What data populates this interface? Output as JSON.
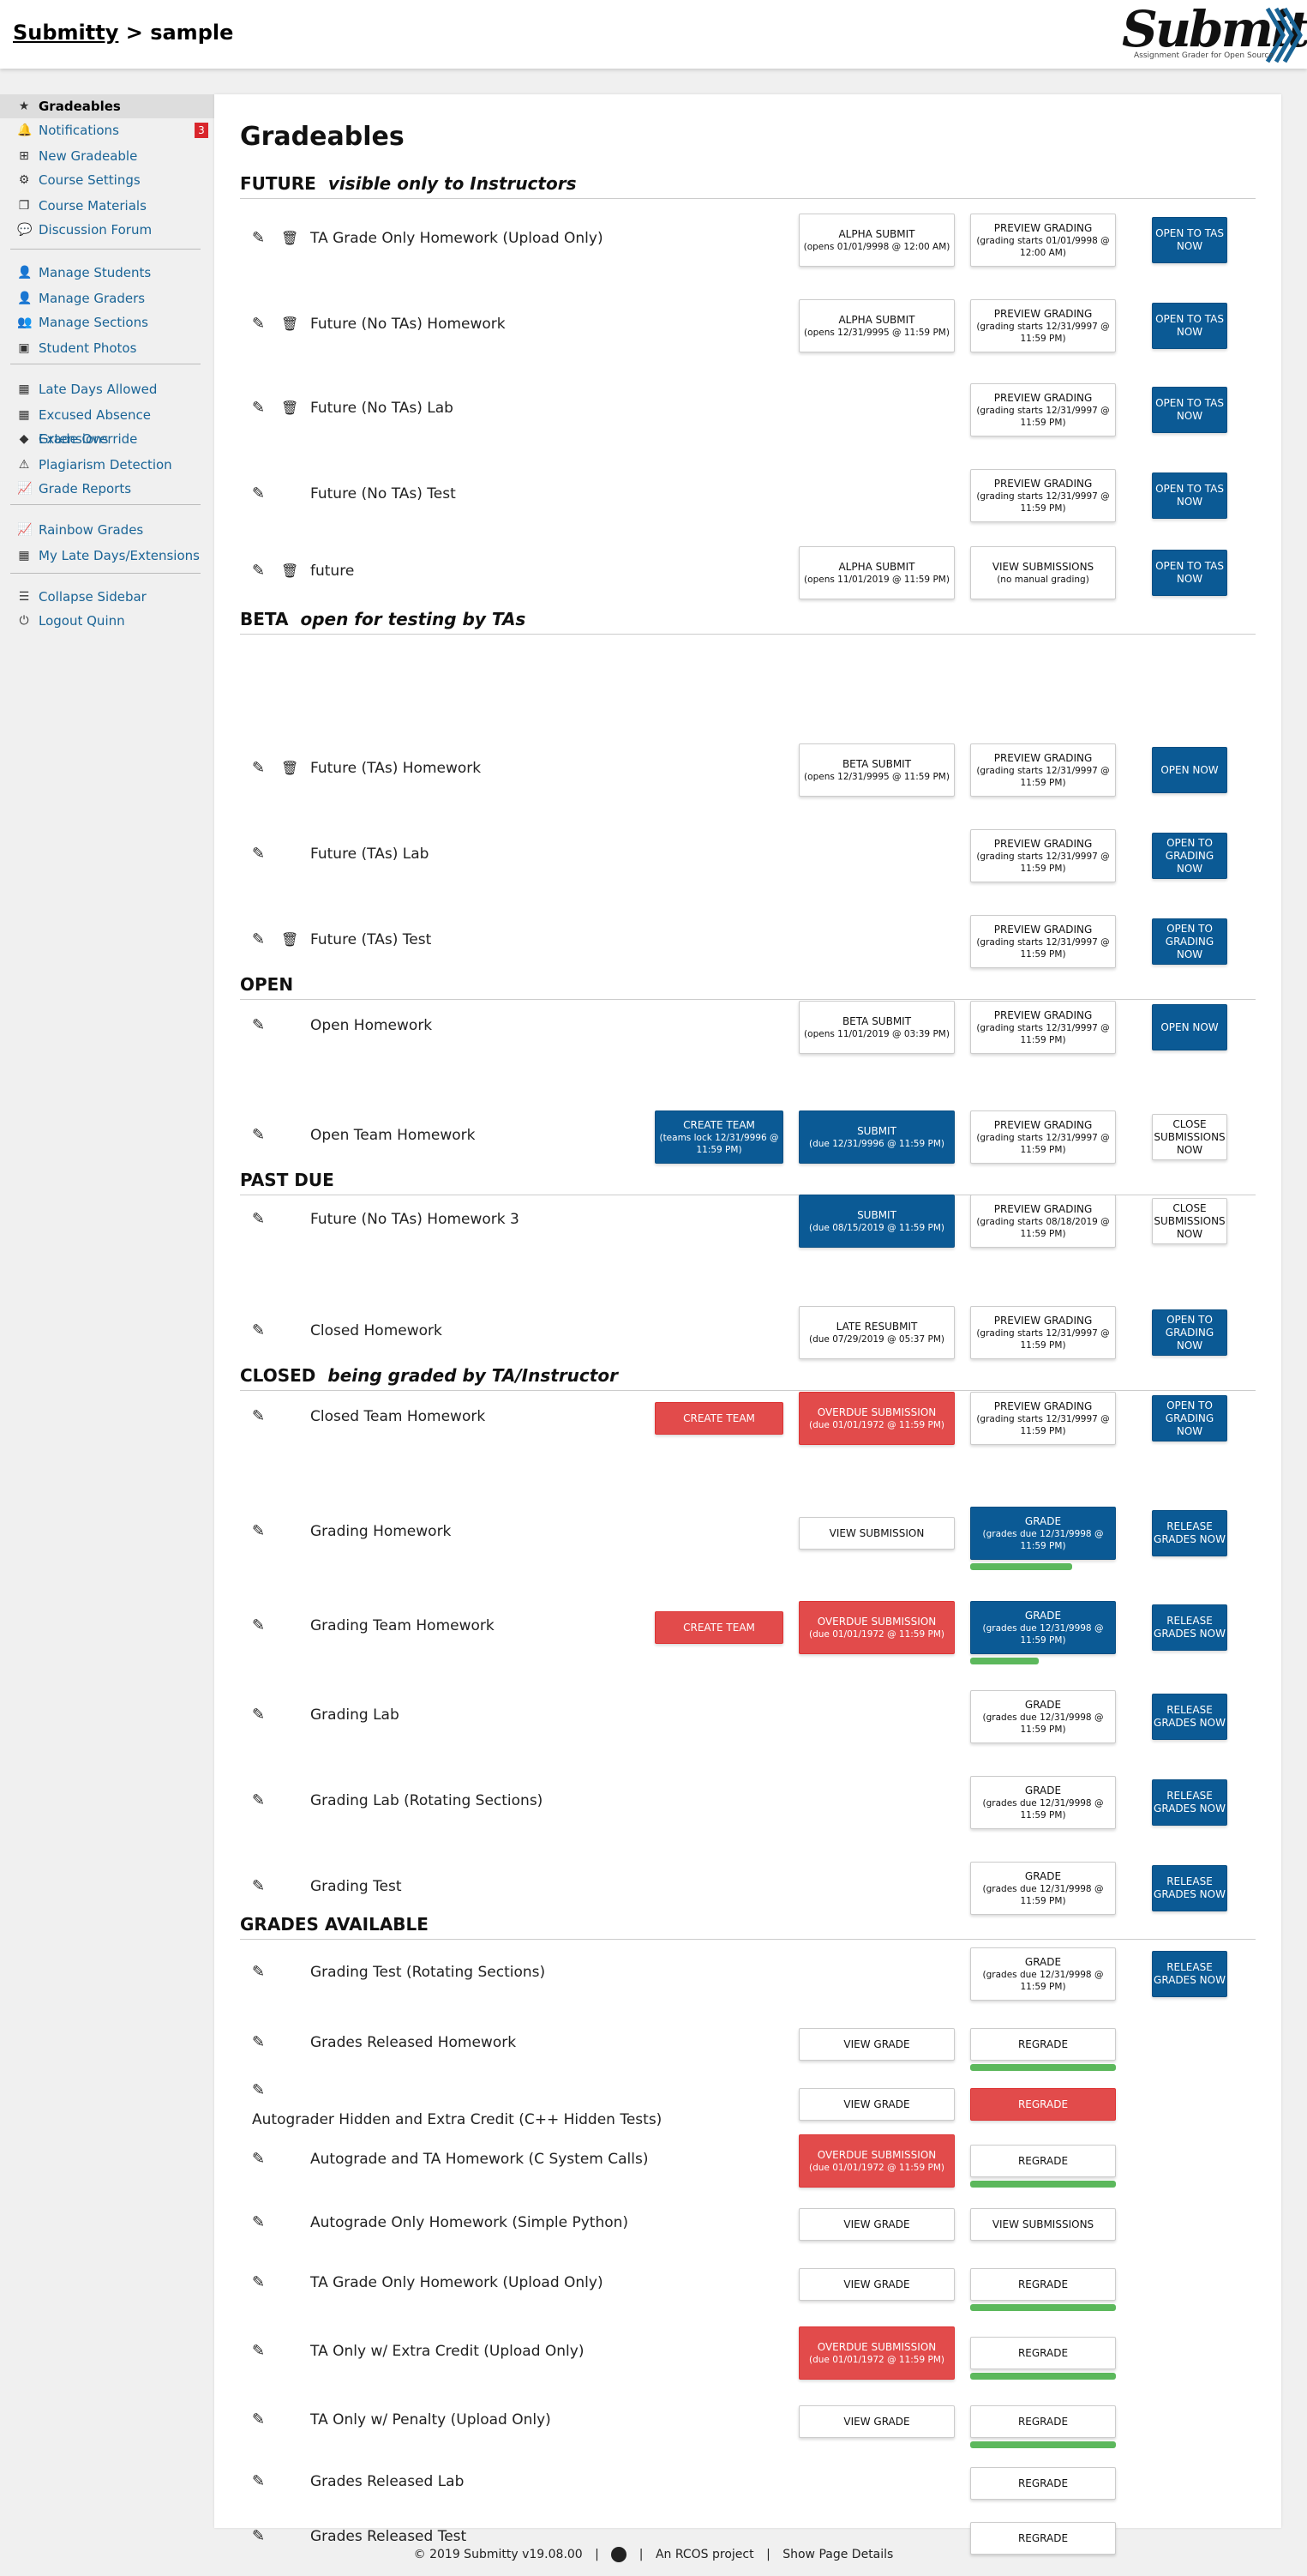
{
  "header": {
    "course_link": "Submitty",
    "separator": ">",
    "course": "sample"
  },
  "logo": {
    "word": "Submitty",
    "tagline": "Assignment Grader for Open Source"
  },
  "sidebar": {
    "items": [
      {
        "label": "Gradeables",
        "icon": "star-icon",
        "glyph": "★"
      },
      {
        "label": "Notifications",
        "icon": "bell-icon",
        "glyph": "🔔",
        "badge": "3"
      },
      {
        "label": "New Gradeable",
        "icon": "plus-square-icon",
        "glyph": "⊞"
      },
      {
        "label": "Course Settings",
        "icon": "gear-icon",
        "glyph": "⚙"
      },
      {
        "label": "Course Materials",
        "icon": "copy-icon",
        "glyph": "❐"
      },
      {
        "label": "Discussion Forum",
        "icon": "comments-icon",
        "glyph": "💬"
      },
      {
        "label": "Manage Students",
        "icon": "user-graduate-icon",
        "glyph": "👤"
      },
      {
        "label": "Manage Graders",
        "icon": "user-tie-icon",
        "glyph": "👤"
      },
      {
        "label": "Manage Sections",
        "icon": "users-icon",
        "glyph": "👥"
      },
      {
        "label": "Student Photos",
        "icon": "id-card-icon",
        "glyph": "▣"
      },
      {
        "label": "Late Days Allowed",
        "icon": "calendar-check-icon",
        "glyph": "▦"
      },
      {
        "label": "Excused Absence Extensions",
        "icon": "calendar-plus-icon",
        "glyph": "▦"
      },
      {
        "label": "Grade Override",
        "icon": "eraser-icon",
        "glyph": "◆"
      },
      {
        "label": "Plagiarism Detection",
        "icon": "warning-icon",
        "glyph": "⚠"
      },
      {
        "label": "Grade Reports",
        "icon": "chart-icon",
        "glyph": "📈"
      },
      {
        "label": "Rainbow Grades",
        "icon": "chart-icon",
        "glyph": "📈"
      },
      {
        "label": "My Late Days/Extensions",
        "icon": "calendar-icon",
        "glyph": "▦"
      },
      {
        "label": "Collapse Sidebar",
        "icon": "bars-icon",
        "glyph": "☰"
      },
      {
        "label": "Logout Quinn",
        "icon": "power-icon",
        "glyph": "⏻"
      }
    ]
  },
  "main": {
    "title": "Gradeables",
    "sections": [
      {
        "name": "FUTURE",
        "subtitle": "visible only to Instructors"
      },
      {
        "name": "BETA",
        "subtitle": "open for testing by TAs"
      },
      {
        "name": "OPEN",
        "subtitle": ""
      },
      {
        "name": "PAST DUE",
        "subtitle": ""
      },
      {
        "name": "CLOSED",
        "subtitle": "being graded by TA/Instructor"
      },
      {
        "name": "GRADES AVAILABLE",
        "subtitle": ""
      }
    ],
    "rows": [
      {
        "title": "TA Grade Only Homework (Upload Only)",
        "trash": true,
        "submit": {
          "label": "ALPHA SUBMIT",
          "sub": "(opens 01/01/9998 @ 12:00 AM)",
          "style": "white"
        },
        "grade": {
          "label": "PREVIEW GRADING",
          "sub": "(grading starts 01/01/9998 @ 12:00 AM)",
          "style": "white"
        },
        "action": {
          "label": "OPEN TO TAS NOW",
          "sub": "",
          "style": "blue"
        }
      },
      {
        "title": "Future (No TAs) Homework",
        "trash": true,
        "submit": {
          "label": "ALPHA SUBMIT",
          "sub": "(opens 12/31/9995 @ 11:59 PM)",
          "style": "white"
        },
        "grade": {
          "label": "PREVIEW GRADING",
          "sub": "(grading starts 12/31/9997 @ 11:59 PM)",
          "style": "white"
        },
        "action": {
          "label": "OPEN TO TAS NOW",
          "sub": "",
          "style": "blue"
        }
      },
      {
        "title": "Future (No TAs) Lab",
        "trash": true,
        "grade": {
          "label": "PREVIEW GRADING",
          "sub": "(grading starts 12/31/9997 @ 11:59 PM)",
          "style": "white"
        },
        "action": {
          "label": "OPEN TO TAS NOW",
          "sub": "",
          "style": "blue"
        }
      },
      {
        "title": "Future (No TAs) Test",
        "trash": false,
        "grade": {
          "label": "PREVIEW GRADING",
          "sub": "(grading starts 12/31/9997 @ 11:59 PM)",
          "style": "white"
        },
        "action": {
          "label": "OPEN TO TAS NOW",
          "sub": "",
          "style": "blue"
        }
      },
      {
        "title": "future",
        "trash": true,
        "submit": {
          "label": "ALPHA SUBMIT",
          "sub": "(opens 11/01/2019 @ 11:59 PM)",
          "style": "white"
        },
        "grade": {
          "label": "VIEW SUBMISSIONS",
          "sub": "(no manual grading)",
          "style": "white"
        },
        "action": {
          "label": "OPEN TO TAS NOW",
          "sub": "",
          "style": "blue"
        }
      },
      {
        "title": "Future (TAs) Homework",
        "trash": true,
        "submit": {
          "label": "BETA SUBMIT",
          "sub": "(opens 12/31/9995 @ 11:59 PM)",
          "style": "white"
        },
        "grade": {
          "label": "PREVIEW GRADING",
          "sub": "(grading starts 12/31/9997 @ 11:59 PM)",
          "style": "white"
        },
        "action": {
          "label": "OPEN NOW",
          "sub": "",
          "style": "blue"
        }
      },
      {
        "title": "Future (TAs) Lab",
        "trash": false,
        "grade": {
          "label": "PREVIEW GRADING",
          "sub": "(grading starts 12/31/9997 @ 11:59 PM)",
          "style": "white"
        },
        "action": {
          "label": "OPEN TO GRADING NOW",
          "sub": "",
          "style": "blue"
        }
      },
      {
        "title": "Future (TAs) Test",
        "trash": true,
        "grade": {
          "label": "PREVIEW GRADING",
          "sub": "(grading starts 12/31/9997 @ 11:59 PM)",
          "style": "white"
        },
        "action": {
          "label": "OPEN TO GRADING NOW",
          "sub": "",
          "style": "blue"
        }
      },
      {
        "title": "Open Homework",
        "trash": false,
        "submit": {
          "label": "BETA SUBMIT",
          "sub": "(opens 11/01/2019 @ 03:39 PM)",
          "style": "white"
        },
        "grade": {
          "label": "PREVIEW GRADING",
          "sub": "(grading starts 12/31/9997 @ 11:59 PM)",
          "style": "white"
        },
        "action": {
          "label": "OPEN NOW",
          "sub": "",
          "style": "blue"
        }
      },
      {
        "title": "Open Team Homework",
        "trash": false,
        "team": {
          "label": "CREATE TEAM",
          "sub": "(teams lock 12/31/9996 @ 11:59 PM)",
          "style": "blue"
        },
        "submit": {
          "label": "SUBMIT",
          "sub": "(due 12/31/9996 @ 11:59 PM)",
          "style": "blue"
        },
        "grade": {
          "label": "PREVIEW GRADING",
          "sub": "(grading starts 12/31/9997 @ 11:59 PM)",
          "style": "white"
        },
        "action": {
          "label": "CLOSE SUBMISSIONS NOW",
          "sub": "",
          "style": "white"
        }
      },
      {
        "title": "Future (No TAs) Homework 3",
        "trash": false,
        "submit": {
          "label": "SUBMIT",
          "sub": "(due 08/15/2019 @ 11:59 PM)",
          "style": "blue"
        },
        "grade": {
          "label": "PREVIEW GRADING",
          "sub": "(grading starts 08/18/2019 @ 11:59 PM)",
          "style": "white"
        },
        "action": {
          "label": "CLOSE SUBMISSIONS NOW",
          "sub": "",
          "style": "white"
        }
      },
      {
        "title": "Closed Homework",
        "trash": false,
        "submit": {
          "label": "LATE RESUBMIT",
          "sub": "(due 07/29/2019 @ 05:37 PM)",
          "style": "white"
        },
        "grade": {
          "label": "PREVIEW GRADING",
          "sub": "(grading starts 12/31/9997 @ 11:59 PM)",
          "style": "white"
        },
        "action": {
          "label": "OPEN TO GRADING NOW",
          "sub": "",
          "style": "blue"
        }
      },
      {
        "title": "Closed Team Homework",
        "trash": false,
        "team": {
          "label": "CREATE TEAM",
          "sub": "",
          "style": "red"
        },
        "submit": {
          "label": "OVERDUE SUBMISSION",
          "sub": "(due 01/01/1972 @ 11:59 PM)",
          "style": "red"
        },
        "grade": {
          "label": "PREVIEW GRADING",
          "sub": "(grading starts 12/31/9997 @ 11:59 PM)",
          "style": "white"
        },
        "action": {
          "label": "OPEN TO GRADING NOW",
          "sub": "",
          "style": "blue"
        }
      },
      {
        "title": "Grading Homework",
        "trash": false,
        "submit": {
          "label": "VIEW SUBMISSION",
          "sub": "",
          "style": "white"
        },
        "grade": {
          "label": "GRADE",
          "sub": "(grades due 12/31/9998 @ 11:59 PM)",
          "style": "blue",
          "progress": 0.7
        },
        "action": {
          "label": "RELEASE GRADES NOW",
          "sub": "",
          "style": "blue"
        }
      },
      {
        "title": "Grading Team Homework",
        "trash": false,
        "team": {
          "label": "CREATE TEAM",
          "sub": "",
          "style": "red"
        },
        "submit": {
          "label": "OVERDUE SUBMISSION",
          "sub": "(due 01/01/1972 @ 11:59 PM)",
          "style": "red"
        },
        "grade": {
          "label": "GRADE",
          "sub": "(grades due 12/31/9998 @ 11:59 PM)",
          "style": "blue",
          "progress": 0.47
        },
        "action": {
          "label": "RELEASE GRADES NOW",
          "sub": "",
          "style": "blue"
        }
      },
      {
        "title": "Grading Lab",
        "trash": false,
        "grade": {
          "label": "GRADE",
          "sub": "(grades due 12/31/9998 @ 11:59 PM)",
          "style": "white"
        },
        "action": {
          "label": "RELEASE GRADES NOW",
          "sub": "",
          "style": "blue"
        }
      },
      {
        "title": "Grading Lab (Rotating Sections)",
        "trash": false,
        "grade": {
          "label": "GRADE",
          "sub": "(grades due 12/31/9998 @ 11:59 PM)",
          "style": "white"
        },
        "action": {
          "label": "RELEASE GRADES NOW",
          "sub": "",
          "style": "blue"
        }
      },
      {
        "title": "Grading Test",
        "trash": false,
        "grade": {
          "label": "GRADE",
          "sub": "(grades due 12/31/9998 @ 11:59 PM)",
          "style": "white"
        },
        "action": {
          "label": "RELEASE GRADES NOW",
          "sub": "",
          "style": "blue"
        }
      },
      {
        "title": "Grading Test (Rotating Sections)",
        "trash": false,
        "grade": {
          "label": "GRADE",
          "sub": "(grades due 12/31/9998 @ 11:59 PM)",
          "style": "white"
        },
        "action": {
          "label": "RELEASE GRADES NOW",
          "sub": "",
          "style": "blue"
        }
      },
      {
        "title": "Grades Released Homework",
        "trash": false,
        "submit": {
          "label": "VIEW GRADE",
          "sub": "",
          "style": "white"
        },
        "grade": {
          "label": "REGRADE",
          "sub": "",
          "style": "white",
          "progress": 1.0
        }
      },
      {
        "title": "Autograder Hidden and Extra Credit (C++ Hidden Tests)",
        "trash": false,
        "wrap": true,
        "submit": {
          "label": "VIEW GRADE",
          "sub": "",
          "style": "white"
        },
        "grade": {
          "label": "REGRADE",
          "sub": "",
          "style": "red"
        }
      },
      {
        "title": "Autograde and TA Homework (C System Calls)",
        "trash": false,
        "submit": {
          "label": "OVERDUE SUBMISSION",
          "sub": "(due 01/01/1972 @ 11:59 PM)",
          "style": "red"
        },
        "grade": {
          "label": "REGRADE",
          "sub": "",
          "style": "white",
          "progress": 1.0
        }
      },
      {
        "title": "Autograde Only Homework (Simple Python)",
        "trash": false,
        "submit": {
          "label": "VIEW GRADE",
          "sub": "",
          "style": "white"
        },
        "grade": {
          "label": "VIEW SUBMISSIONS",
          "sub": "",
          "style": "white"
        }
      },
      {
        "title": "TA Grade Only Homework (Upload Only)",
        "trash": false,
        "submit": {
          "label": "VIEW GRADE",
          "sub": "",
          "style": "white"
        },
        "grade": {
          "label": "REGRADE",
          "sub": "",
          "style": "white",
          "progress": 1.0
        }
      },
      {
        "title": "TA Only w/ Extra Credit (Upload Only)",
        "trash": false,
        "submit": {
          "label": "OVERDUE SUBMISSION",
          "sub": "(due 01/01/1972 @ 11:59 PM)",
          "style": "red"
        },
        "grade": {
          "label": "REGRADE",
          "sub": "",
          "style": "white",
          "progress": 1.0
        }
      },
      {
        "title": "TA Only w/ Penalty (Upload Only)",
        "trash": false,
        "submit": {
          "label": "VIEW GRADE",
          "sub": "",
          "style": "white"
        },
        "grade": {
          "label": "REGRADE",
          "sub": "",
          "style": "white",
          "progress": 1.0
        }
      },
      {
        "title": "Grades Released Lab",
        "trash": false,
        "grade": {
          "label": "REGRADE",
          "sub": "",
          "style": "white"
        }
      },
      {
        "title": "Grades Released Test",
        "trash": false,
        "grade": {
          "label": "REGRADE",
          "sub": "",
          "style": "white"
        }
      }
    ]
  },
  "footer": {
    "copyright": "© 2019 Submitty v19.08.00",
    "project": "An RCOS project",
    "details": "Show Page Details"
  }
}
